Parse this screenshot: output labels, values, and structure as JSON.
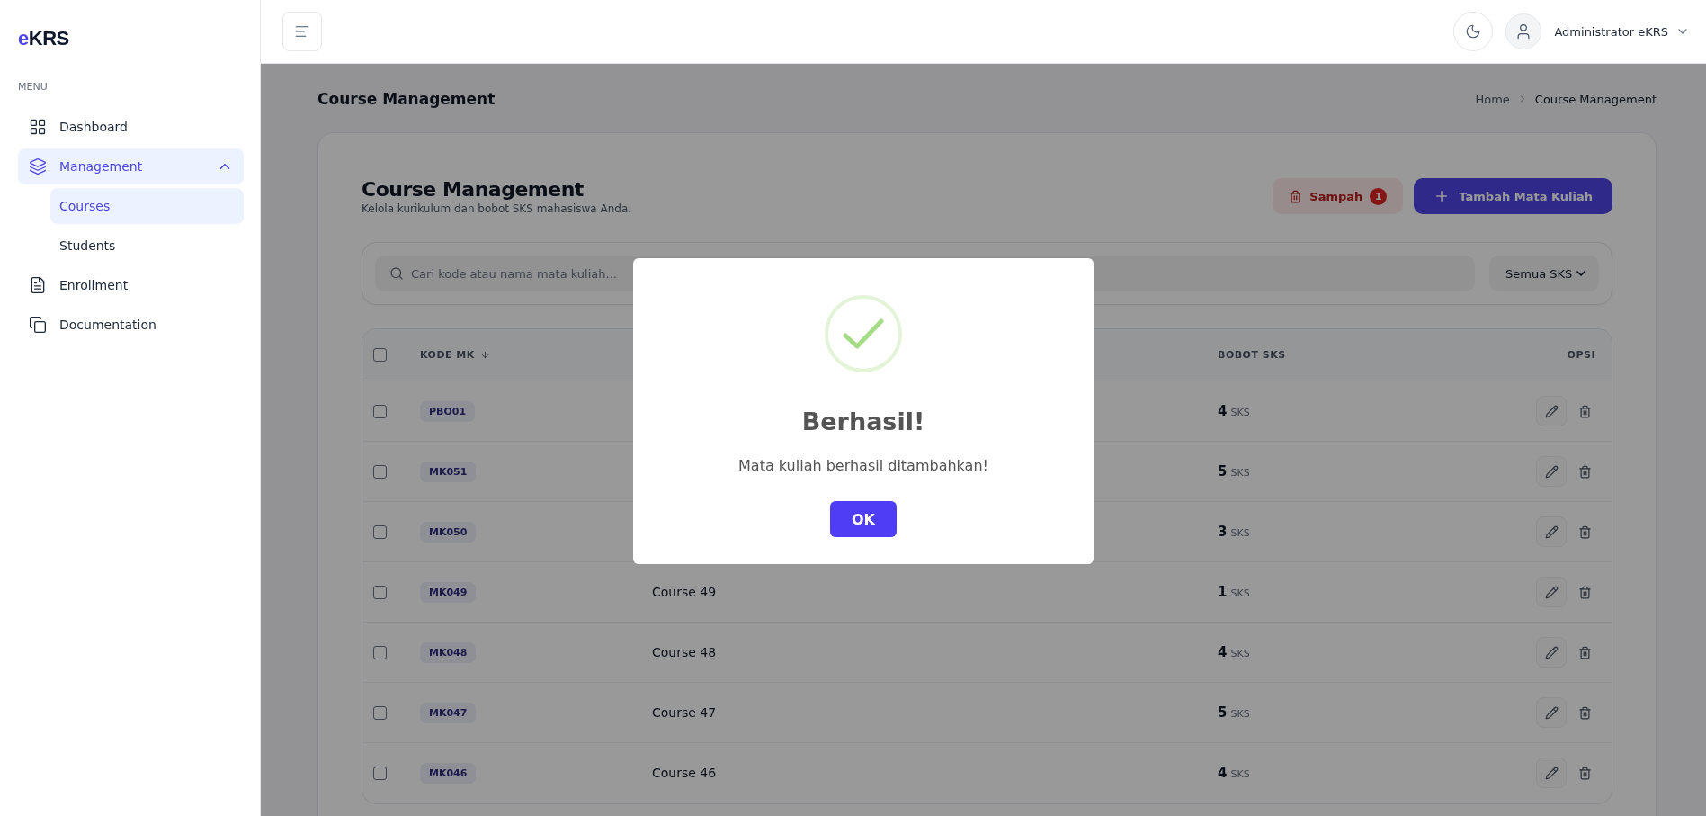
{
  "sidebar": {
    "logo": {
      "accent": "e",
      "rest": "KRS"
    },
    "menu_label": "MENU",
    "items": [
      {
        "label": "Dashboard",
        "selected": false
      },
      {
        "label": "Management",
        "selected": true,
        "expanded": true,
        "children": [
          {
            "label": "Courses",
            "selected": true
          },
          {
            "label": "Students",
            "selected": false
          }
        ]
      },
      {
        "label": "Enrollment",
        "selected": false
      },
      {
        "label": "Documentation",
        "selected": false
      }
    ]
  },
  "header": {
    "user_name": "Administrator eKRS"
  },
  "page": {
    "title": "Course Management",
    "breadcrumb": [
      "Home",
      "Course Management"
    ]
  },
  "card": {
    "title": "Course Management",
    "subtitle": "Kelola kurikulum dan bobot SKS mahasiswa Anda.",
    "trash_button": {
      "label": "Sampah",
      "count": "1"
    },
    "add_button": {
      "label": "Tambah Mata Kuliah"
    },
    "search": {
      "placeholder": "Cari kode atau nama mata kuliah..."
    },
    "filter": {
      "value": "Semua SKS"
    }
  },
  "table": {
    "all_checked": false,
    "header": {
      "code": "KODE MK",
      "code_sorted": true,
      "credits": "BOBOT SKS",
      "options": "OPSI"
    },
    "rows": [
      {
        "checked": false,
        "code": "PBO01",
        "credits": "4",
        "unit": "SKS"
      },
      {
        "checked": false,
        "code": "MK051",
        "credits": "5",
        "unit": "SKS"
      },
      {
        "checked": false,
        "code": "MK050",
        "credits": "3",
        "unit": "SKS"
      },
      {
        "checked": false,
        "code": "MK049",
        "name": "Course 49",
        "credits": "1",
        "unit": "SKS"
      },
      {
        "checked": false,
        "code": "MK048",
        "name": "Course 48",
        "credits": "4",
        "unit": "SKS"
      },
      {
        "checked": false,
        "code": "MK047",
        "name": "Course 47",
        "credits": "5",
        "unit": "SKS"
      },
      {
        "checked": false,
        "code": "MK046",
        "name": "Course 46",
        "credits": "4",
        "unit": "SKS"
      }
    ]
  },
  "dialog": {
    "title": "Berhasil!",
    "message": "Mata kuliah berhasil ditambahkan!",
    "button": "OK"
  }
}
